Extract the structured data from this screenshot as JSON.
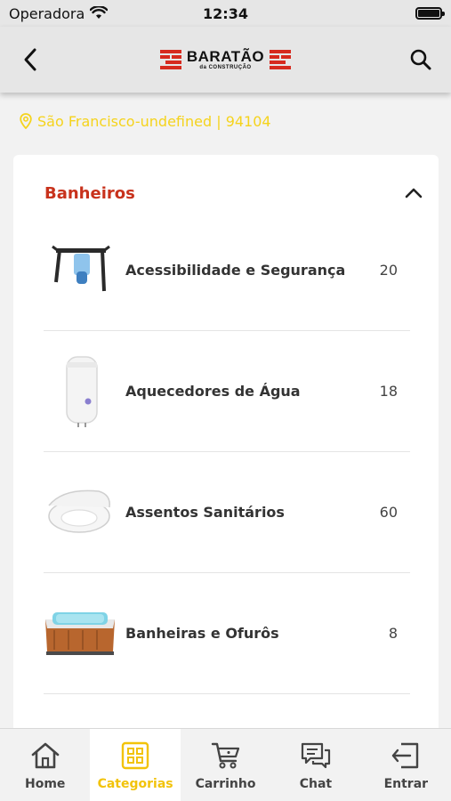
{
  "status_bar": {
    "carrier": "Operadora",
    "time": "12:34"
  },
  "header": {
    "logo_main": "BARATÃO",
    "logo_sub": "da CONSTRUÇÃO"
  },
  "location": {
    "text": "São Francisco-undefined | 94104"
  },
  "category": {
    "title": "Banheiros",
    "items": [
      {
        "label": "Acessibilidade e Segurança",
        "count": "20",
        "icon": "grab-bar-icon"
      },
      {
        "label": "Aquecedores de Água",
        "count": "18",
        "icon": "water-heater-icon"
      },
      {
        "label": "Assentos Sanitários",
        "count": "60",
        "icon": "toilet-seat-icon"
      },
      {
        "label": "Banheiras e Ofurôs",
        "count": "8",
        "icon": "bathtub-icon"
      }
    ]
  },
  "nav": {
    "items": [
      {
        "label": "Home",
        "icon": "home-icon"
      },
      {
        "label": "Categorias",
        "icon": "categories-icon"
      },
      {
        "label": "Carrinho",
        "icon": "cart-icon"
      },
      {
        "label": "Chat",
        "icon": "chat-icon"
      },
      {
        "label": "Entrar",
        "icon": "login-icon"
      }
    ],
    "active": "Categorias"
  },
  "colors": {
    "accent": "#f2c30a",
    "brand_red": "#c8321c",
    "location_yellow": "#f5d31c"
  }
}
